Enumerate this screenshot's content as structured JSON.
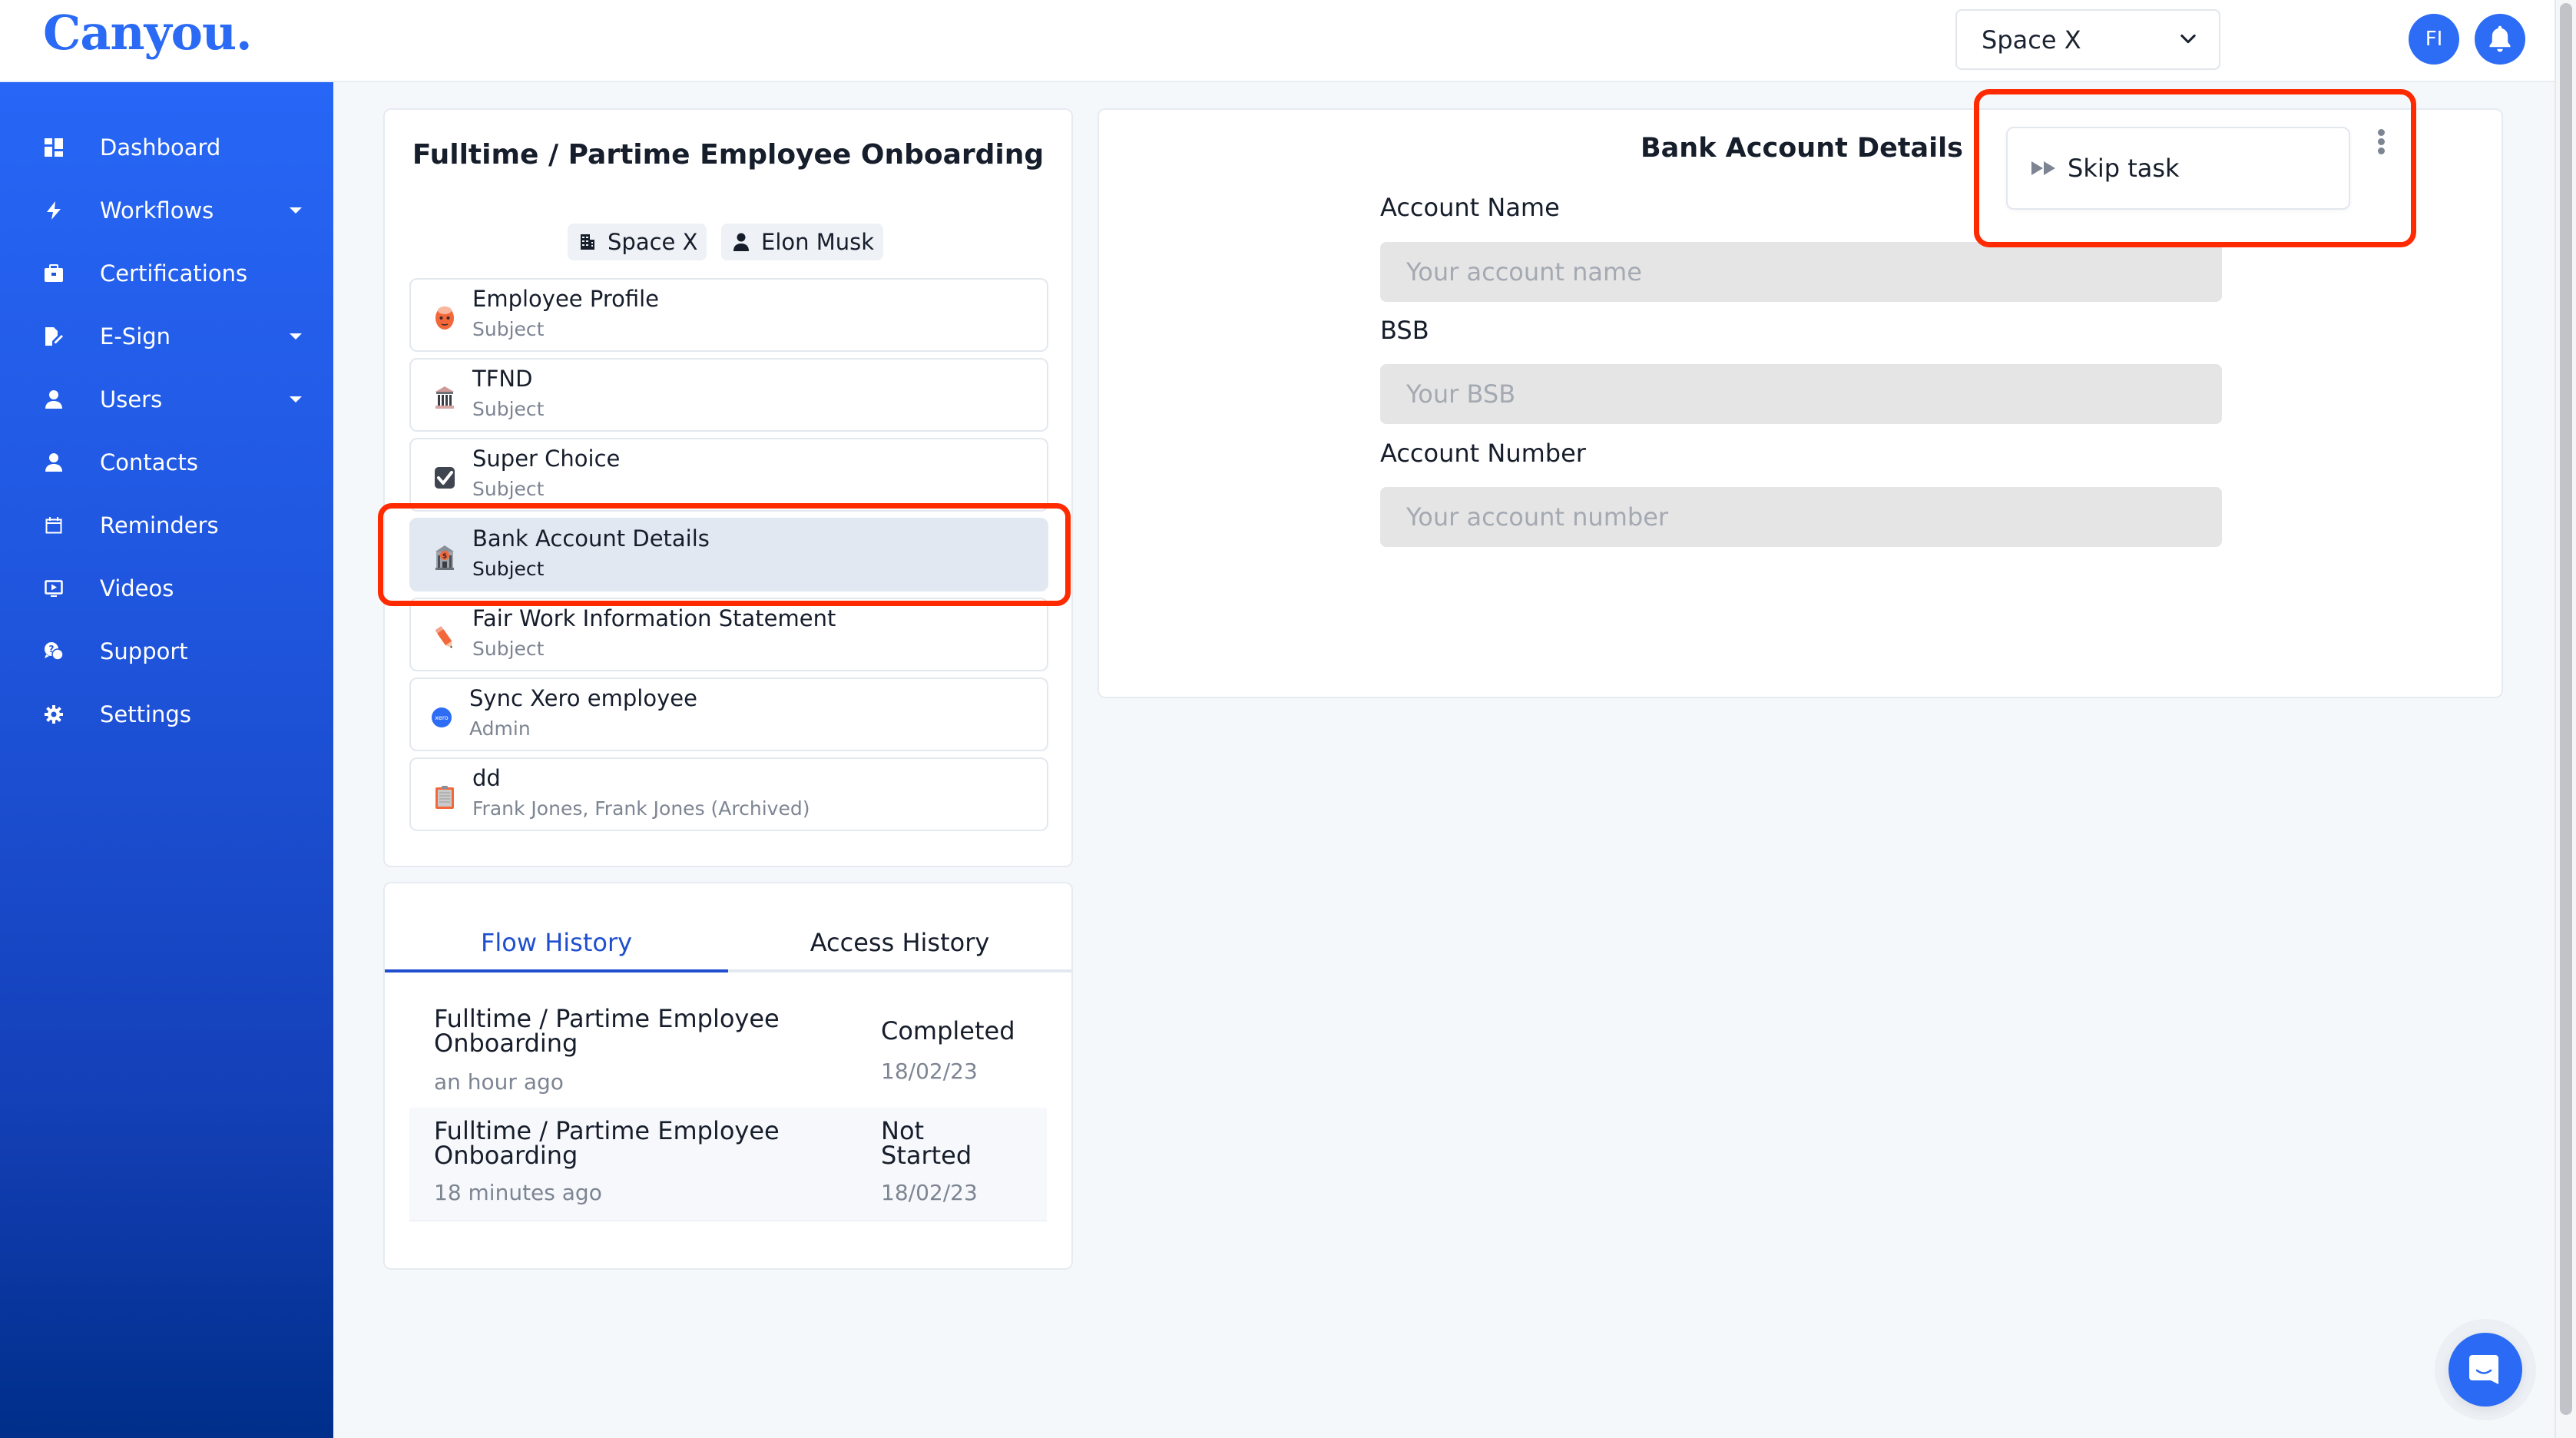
{
  "app": {
    "logo_text": "Canyou.",
    "accent_color": "#2a6af4"
  },
  "header": {
    "space_select_value": "Space X",
    "avatar_initials": "FI"
  },
  "sidebar": {
    "items": [
      {
        "label": "Dashboard",
        "icon": "dashboard-icon",
        "has_caret": false
      },
      {
        "label": "Workflows",
        "icon": "lightning-icon",
        "has_caret": true
      },
      {
        "label": "Certifications",
        "icon": "briefcase-icon",
        "has_caret": false
      },
      {
        "label": "E-Sign",
        "icon": "signature-icon",
        "has_caret": true
      },
      {
        "label": "Users",
        "icon": "user-icon",
        "has_caret": true
      },
      {
        "label": "Contacts",
        "icon": "user-icon",
        "has_caret": false
      },
      {
        "label": "Reminders",
        "icon": "calendar-icon",
        "has_caret": false
      },
      {
        "label": "Videos",
        "icon": "video-icon",
        "has_caret": false
      },
      {
        "label": "Support",
        "icon": "support-chat-icon",
        "has_caret": false
      },
      {
        "label": "Settings",
        "icon": "gear-icon",
        "has_caret": false
      }
    ]
  },
  "workflow": {
    "title": "Fulltime / Partime Employee Onboarding",
    "chips": [
      {
        "label": "Space X",
        "icon": "building-icon"
      },
      {
        "label": "Elon Musk",
        "icon": "user-icon"
      }
    ],
    "tasks": [
      {
        "name": "Employee Profile",
        "sub": "Subject",
        "icon": "profile-face-icon",
        "active": false
      },
      {
        "name": "TFND",
        "sub": "Subject",
        "icon": "bank-building-icon",
        "active": false
      },
      {
        "name": "Super Choice",
        "sub": "Subject",
        "icon": "checkbox-icon",
        "active": false
      },
      {
        "name": "Bank Account Details",
        "sub": "Subject",
        "icon": "bank-dollar-icon",
        "active": true
      },
      {
        "name": "Fair Work Information Statement",
        "sub": "Subject",
        "icon": "pencil-icon",
        "active": false
      },
      {
        "name": "Sync Xero employee",
        "sub": "Admin",
        "icon": "xero-icon",
        "active": false
      },
      {
        "name": "dd",
        "sub": "Frank Jones, Frank Jones (Archived)",
        "icon": "clipboard-icon",
        "active": false
      }
    ]
  },
  "history": {
    "tabs": [
      {
        "label": "Flow History",
        "active": true
      },
      {
        "label": "Access History",
        "active": false
      }
    ],
    "rows": [
      {
        "title": "Fulltime / Partime Employee Onboarding",
        "time": "an hour ago",
        "status": "Completed",
        "date": "18/02/23"
      },
      {
        "title": "Fulltime / Partime Employee Onboarding",
        "time": "18 minutes ago",
        "status": "Not Started",
        "date": "18/02/23"
      }
    ]
  },
  "form": {
    "title": "Bank Account Details",
    "fields": [
      {
        "label": "Account Name",
        "value": "",
        "placeholder": "Your account name"
      },
      {
        "label": "BSB",
        "value": "",
        "placeholder": "Your BSB"
      },
      {
        "label": "Account Number",
        "value": "",
        "placeholder": "Your account number"
      }
    ],
    "skip_task_label": "Skip task"
  },
  "annotations": {
    "highlight_color": "#ff2a00"
  }
}
